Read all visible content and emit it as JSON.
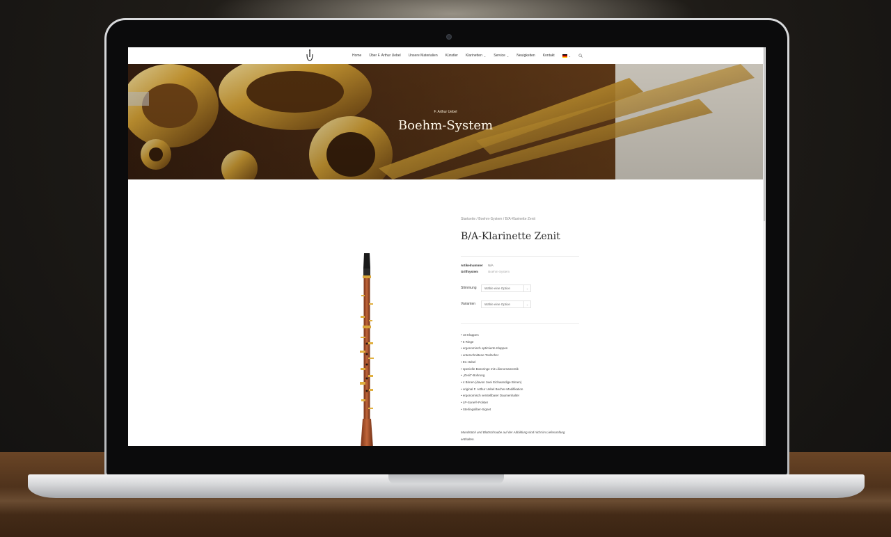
{
  "nav": {
    "items": [
      {
        "label": "Home",
        "has_caret": false
      },
      {
        "label": "Über F. Arthur Uebel",
        "has_caret": false
      },
      {
        "label": "Unsere Materialien",
        "has_caret": false
      },
      {
        "label": "Künstler",
        "has_caret": false
      },
      {
        "label": "Klarinetten",
        "has_caret": true
      },
      {
        "label": "Service",
        "has_caret": true
      },
      {
        "label": "Neuigkeiten",
        "has_caret": false
      },
      {
        "label": "Kontakt",
        "has_caret": false
      }
    ],
    "caret": "⌄",
    "language_icon": "german-flag-icon"
  },
  "hero": {
    "subtitle": "F. Arthur Uebel",
    "title": "Boehm-System"
  },
  "breadcrumb": "Startseite / Boehm-System / B/A-Klarinette Zenit",
  "product": {
    "title": "B/A-Klarinette Zenit",
    "meta": {
      "sku_label": "Artikelnummer",
      "sku_value": "N/A",
      "system_label": "Griffsystem",
      "system_value": "Boehm-System"
    },
    "options": [
      {
        "label": "Stimmung",
        "placeholder": "Wähle eine Option"
      },
      {
        "label": "Varianten",
        "placeholder": "Wähle eine Option"
      }
    ],
    "features": [
      "• 18 Klappen",
      "• 6 Ringe",
      "• ergonomisch optimierte Klappen",
      "• unterschnittene Tonlöcher",
      "• Es-Hebel",
      "• spezielle Bossringe mit Lilienornamentik",
      "• „Zenit“-Bohrung",
      "• 4 Birnen (davon zwei Eichwandige Birnen)",
      "• original F. Arthur Uebel Becher-Modifikation",
      "• ergonomisch verstellbarer Daumenhalter",
      "• LP-Sone®-Polster",
      "• Sterlingsilber-Signet"
    ],
    "note": "Mundstück und Blattschraube auf der Abbildung sind nicht im Lieferumfang enthalten."
  },
  "colors": {
    "gold": "#c89a38",
    "wood": "#9a4a2a",
    "text": "#2a2a2a"
  }
}
